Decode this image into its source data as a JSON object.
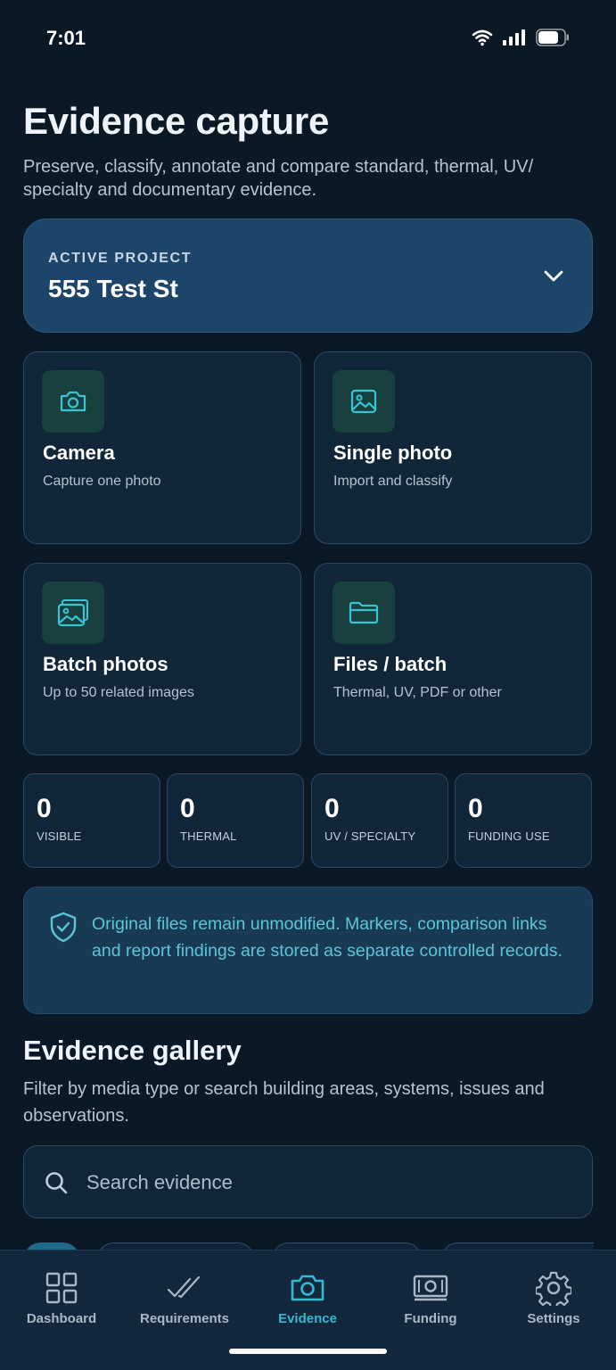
{
  "status_bar": {
    "time": "7:01"
  },
  "page": {
    "title": "Evidence capture",
    "subtitle": "Preserve, classify, annotate and compare standard, thermal, UV/ specialty and documentary evidence."
  },
  "project": {
    "label": "ACTIVE PROJECT",
    "name": "555 Test St"
  },
  "actions": [
    {
      "title": "Camera",
      "desc": "Capture one photo",
      "icon": "camera-icon"
    },
    {
      "title": "Single photo",
      "desc": "Import and classify",
      "icon": "image-icon"
    },
    {
      "title": "Batch photos",
      "desc": "Up to 50 related images",
      "icon": "images-icon"
    },
    {
      "title": "Files / batch",
      "desc": "Thermal, UV, PDF or other",
      "icon": "folder-icon"
    }
  ],
  "stats": [
    {
      "value": "0",
      "label": "VISIBLE"
    },
    {
      "value": "0",
      "label": "THERMAL"
    },
    {
      "value": "0",
      "label": "UV / SPECIALTY"
    },
    {
      "value": "0",
      "label": "FUNDING USE"
    }
  ],
  "notice": {
    "text": "Original files remain unmodified. Markers, comparison links and report findings are stored as separate controlled records.",
    "icon": "shield-check-icon"
  },
  "gallery": {
    "title": "Evidence gallery",
    "desc": "Filter by media type or search building areas, systems, issues and observations.",
    "search_placeholder": "Search evidence"
  },
  "tabs": [
    {
      "label": "Dashboard",
      "icon": "grid-icon",
      "active": false
    },
    {
      "label": "Requirements",
      "icon": "double-check-icon",
      "active": false
    },
    {
      "label": "Evidence",
      "icon": "camera-icon",
      "active": true
    },
    {
      "label": "Funding",
      "icon": "banknote-icon",
      "active": false
    },
    {
      "label": "Settings",
      "icon": "gear-icon",
      "active": false
    }
  ],
  "colors": {
    "accent": "#35b9d2",
    "background": "#0b1826",
    "card": "#12263a",
    "project_card": "#1d4469"
  }
}
